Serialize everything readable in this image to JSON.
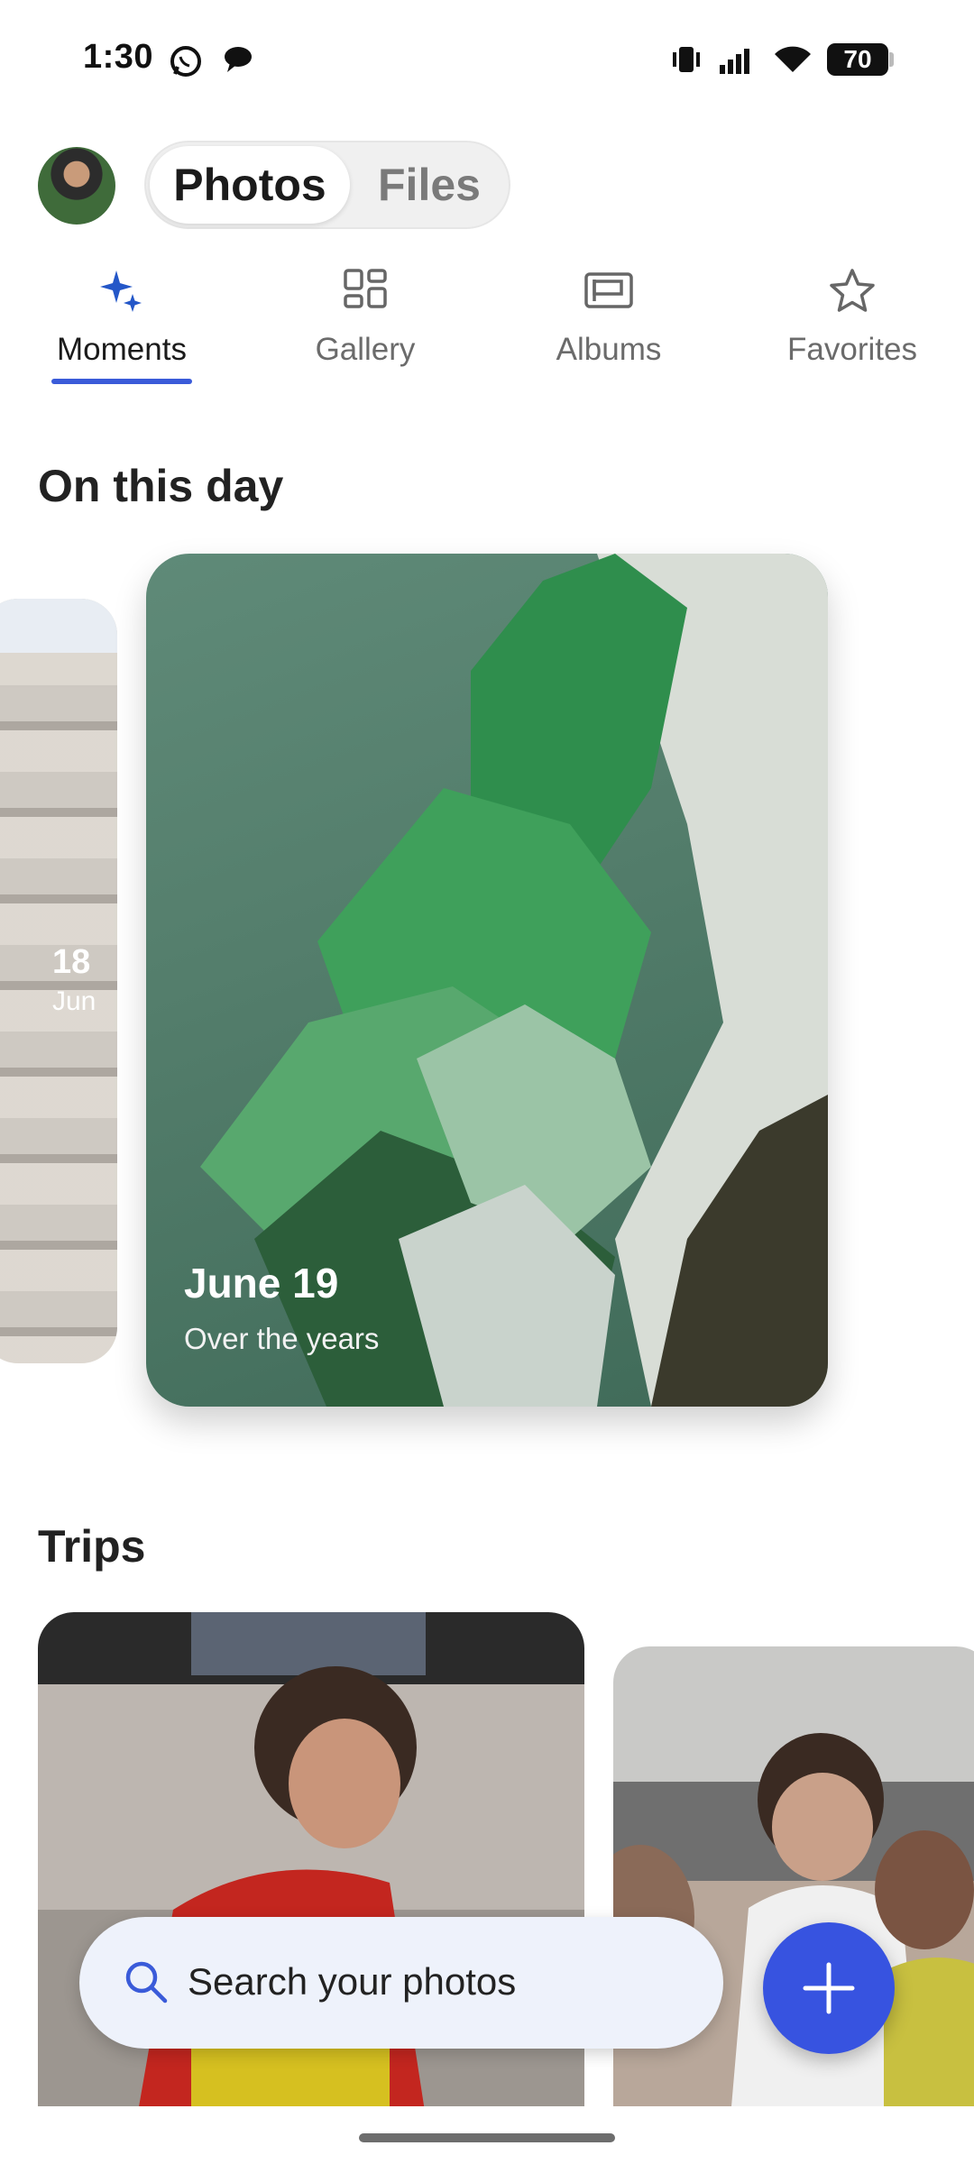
{
  "status_bar": {
    "time": "1:30",
    "battery": "70",
    "left_icons": [
      "whatsapp-icon",
      "chat-bubble-icon"
    ],
    "right_icons": [
      "vibrate-icon",
      "signal-icon",
      "wifi-icon",
      "battery-icon"
    ]
  },
  "header": {
    "segments": [
      {
        "label": "Photos",
        "selected": true
      },
      {
        "label": "Files",
        "selected": false
      }
    ]
  },
  "tabs": [
    {
      "label": "Moments",
      "icon": "sparkle-icon",
      "active": true
    },
    {
      "label": "Gallery",
      "icon": "grid-icon",
      "active": false
    },
    {
      "label": "Albums",
      "icon": "album-icon",
      "active": false
    },
    {
      "label": "Favorites",
      "icon": "star-icon",
      "active": false
    }
  ],
  "on_this_day": {
    "title": "On this day",
    "side_card": {
      "day": "18",
      "month": "Jun"
    },
    "main_card": {
      "title": "June 19",
      "subtitle": "Over the years"
    }
  },
  "trips": {
    "title": "Trips"
  },
  "search": {
    "placeholder": "Search your photos"
  },
  "colors": {
    "accent": "#3a5bd9",
    "fab": "#3753e0",
    "search_bg": "#eef2fb"
  }
}
